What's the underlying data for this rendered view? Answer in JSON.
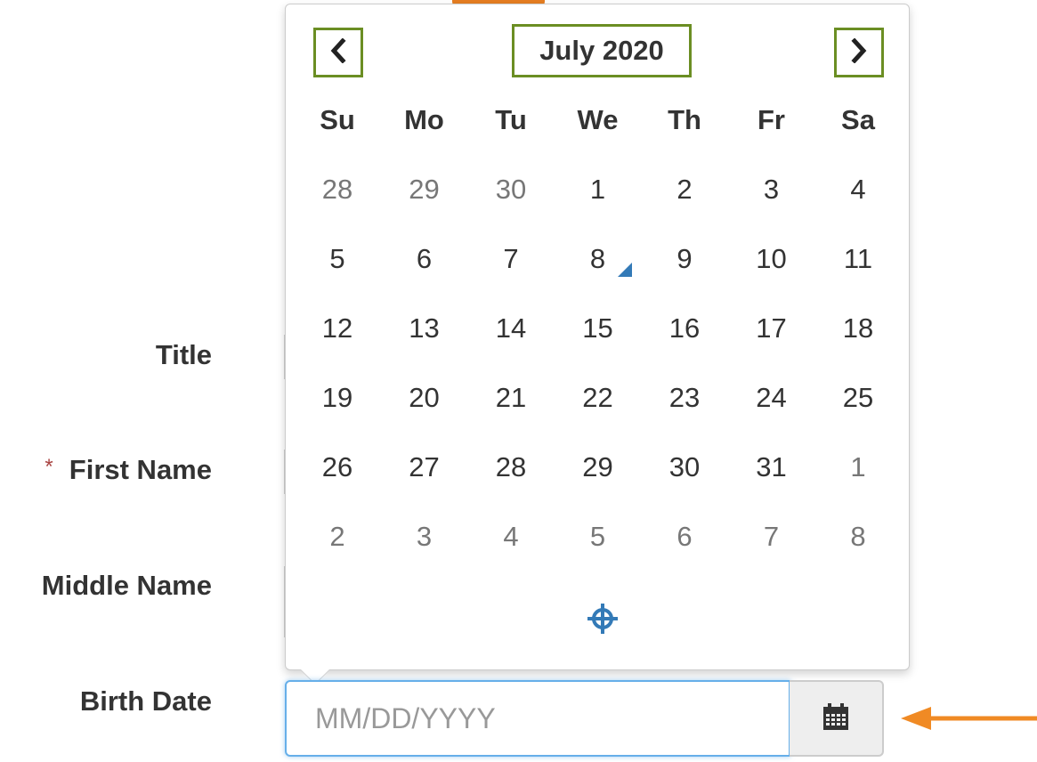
{
  "form": {
    "labels": {
      "title": "Title",
      "first_name": "First Name",
      "middle_name": "Middle Name",
      "birth_date": "Birth Date"
    },
    "required_marker": "*",
    "birth_date_input": {
      "value": "",
      "placeholder": "MM/DD/YYYY"
    }
  },
  "calendar": {
    "month_title": "July 2020",
    "weekdays": [
      "Su",
      "Mo",
      "Tu",
      "We",
      "Th",
      "Fr",
      "Sa"
    ],
    "weeks": [
      [
        {
          "d": "28",
          "muted": true
        },
        {
          "d": "29",
          "muted": true
        },
        {
          "d": "30",
          "muted": true
        },
        {
          "d": "1"
        },
        {
          "d": "2"
        },
        {
          "d": "3"
        },
        {
          "d": "4"
        }
      ],
      [
        {
          "d": "5"
        },
        {
          "d": "6"
        },
        {
          "d": "7"
        },
        {
          "d": "8",
          "today": true
        },
        {
          "d": "9"
        },
        {
          "d": "10"
        },
        {
          "d": "11"
        }
      ],
      [
        {
          "d": "12"
        },
        {
          "d": "13"
        },
        {
          "d": "14"
        },
        {
          "d": "15"
        },
        {
          "d": "16"
        },
        {
          "d": "17"
        },
        {
          "d": "18"
        }
      ],
      [
        {
          "d": "19"
        },
        {
          "d": "20"
        },
        {
          "d": "21"
        },
        {
          "d": "22"
        },
        {
          "d": "23"
        },
        {
          "d": "24"
        },
        {
          "d": "25"
        }
      ],
      [
        {
          "d": "26"
        },
        {
          "d": "27"
        },
        {
          "d": "28"
        },
        {
          "d": "29"
        },
        {
          "d": "30"
        },
        {
          "d": "31"
        },
        {
          "d": "1",
          "muted": true
        }
      ],
      [
        {
          "d": "2",
          "muted": true
        },
        {
          "d": "3",
          "muted": true
        },
        {
          "d": "4",
          "muted": true
        },
        {
          "d": "5",
          "muted": true
        },
        {
          "d": "6",
          "muted": true
        },
        {
          "d": "7",
          "muted": true
        },
        {
          "d": "8",
          "muted": true
        }
      ]
    ],
    "icons": {
      "prev": "chevron-left-icon",
      "next": "chevron-right-icon",
      "today": "crosshairs-icon",
      "calendar": "calendar-icon"
    }
  },
  "colors": {
    "highlight_box": "#6b8e23",
    "accent_blue": "#337ab7",
    "focus_border": "#66afe9",
    "annotation_arrow": "#f08a24",
    "required": "#a94442"
  }
}
